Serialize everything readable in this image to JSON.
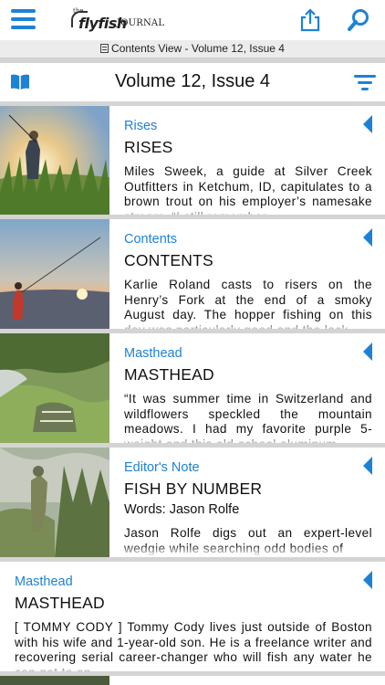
{
  "topbar": {
    "logo_small": "the",
    "logo_word1": "flyfish",
    "logo_word2": "JOURNAL"
  },
  "subbar": {
    "text": "Contents View - Volume 12, Issue 4"
  },
  "issuebar": {
    "title": "Volume 12, Issue 4"
  },
  "colors": {
    "accent": "#1d82d6",
    "separator": "#d4d4d4"
  },
  "articles": [
    {
      "section": "Rises",
      "headline": "RISES",
      "byline": "",
      "teaser": "Miles Sweek, a guide at Silver Creek Outfitters in Ketchum, ID, capitulates to a brown trout on his employer’s namesake stream. “I still remember",
      "image": "angler-golden-meadow"
    },
    {
      "section": "Contents",
      "headline": "CONTENTS",
      "byline": "",
      "teaser": "Karlie Roland casts to risers on the Henry’s Fork at the end of a smoky August day. The hopper fishing on this day was particularly good and the lack",
      "image": "angler-sunset-river"
    },
    {
      "section": "Masthead",
      "headline": "MASTHEAD",
      "byline": "",
      "teaser": "“It was summer time in Switzerland and wildflowers speckled the mountain meadows. I had my favorite purple 5-weight and this old-school aluminum",
      "image": "backpack-meadow"
    },
    {
      "section": "Editor's Note",
      "headline": "FISH BY NUMBER",
      "byline": "Words: Jason Rolfe",
      "teaser": "Jason Rolfe digs out an expert-level wedgie while searching odd bodies of",
      "image": "angler-willows"
    },
    {
      "section": "Masthead",
      "headline": "MASTHEAD",
      "byline": "",
      "teaser": "[ TOMMY CODY ] Tommy Cody lives just outside of Boston with his wife and 1-year-old son. He is a freelance writer and recovering serial career-changer who will fish any water he can get to on",
      "image": ""
    }
  ]
}
